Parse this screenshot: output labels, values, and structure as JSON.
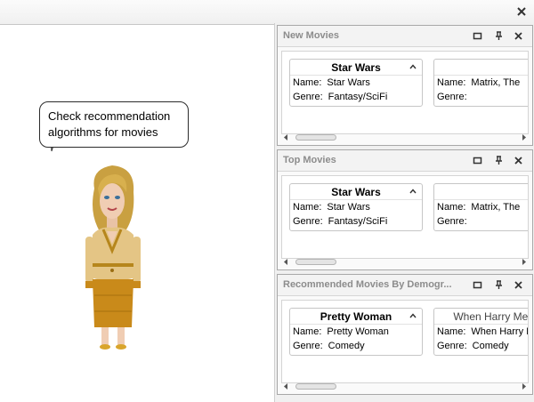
{
  "window": {
    "close_icon": "close-icon"
  },
  "agent": {
    "speech": "Check recommendation algorithms for movies"
  },
  "panels": [
    {
      "title": "New Movies",
      "cards": [
        {
          "header": "Star Wars",
          "name_label": "Name:",
          "name": "Star Wars",
          "genre_label": "Genre:",
          "genre": "Fantasy/SciFi"
        },
        {
          "header": "",
          "name_label": "Name:",
          "name": "Matrix, The",
          "genre_label": "Genre:",
          "genre": ""
        }
      ]
    },
    {
      "title": "Top Movies",
      "cards": [
        {
          "header": "Star Wars",
          "name_label": "Name:",
          "name": "Star Wars",
          "genre_label": "Genre:",
          "genre": "Fantasy/SciFi"
        },
        {
          "header": "",
          "name_label": "Name:",
          "name": "Matrix, The",
          "genre_label": "Genre:",
          "genre": ""
        }
      ]
    },
    {
      "title": "Recommended Movies By Demogr...",
      "cards": [
        {
          "header": "Pretty Woman",
          "name_label": "Name:",
          "name": "Pretty Woman",
          "genre_label": "Genre:",
          "genre": "Comedy"
        },
        {
          "header": "When Harry Met Sa",
          "name_label": "Name:",
          "name": "When Harry M",
          "genre_label": "Genre:",
          "genre": "Comedy"
        }
      ]
    }
  ]
}
